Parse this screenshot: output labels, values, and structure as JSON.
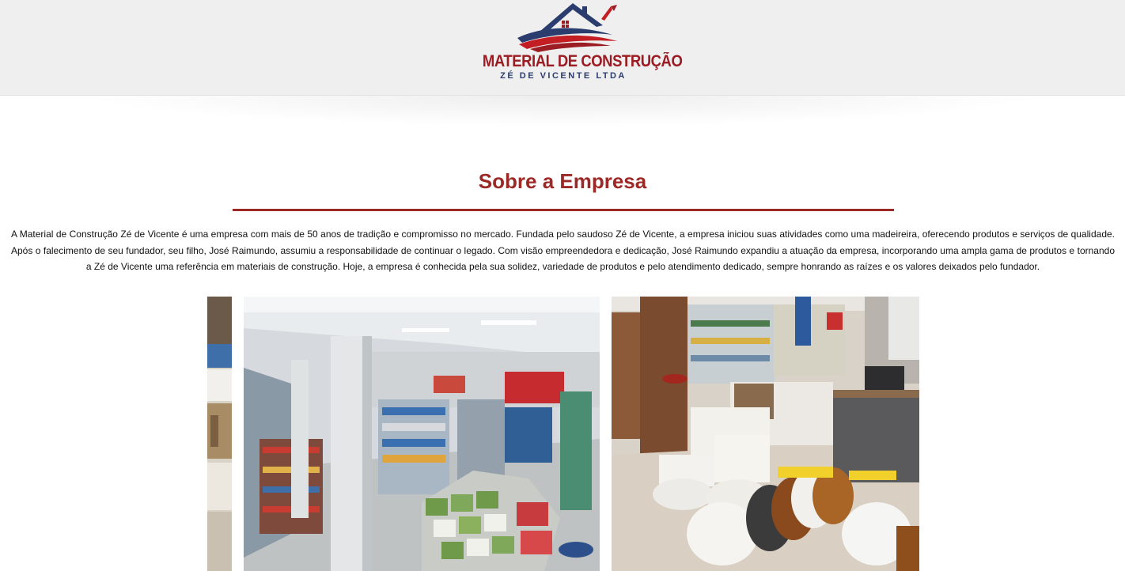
{
  "brand": {
    "title": "MATERIAL DE CONSTRUÇÃO",
    "subtitle": "ZÉ DE VICENTE LTDA",
    "colors": {
      "red": "#9b1c22",
      "navy": "#2b3d6e"
    }
  },
  "about": {
    "heading": "Sobre a Empresa",
    "body": "A Material de Construção Zé de Vicente é uma empresa com mais de 50 anos de tradição e compromisso no mercado. Fundada pelo saudoso Zé de Vicente, a empresa iniciou suas atividades como uma madeireira, oferecendo produtos e serviços de qualidade. Após o falecimento de seu fundador, seu filho, José Raimundo, assumiu a responsabilidade de continuar o legado. Com visão empreendedora e dedicação, José Raimundo expandiu a atuação da empresa, incorporando uma ampla gama de produtos e tornando a Zé de Vicente uma referência em materiais de construção. Hoje, a empresa é conhecida pela sua solidez, variedade de produtos e pelo atendimento dedicado, sempre honrando as raízes e os valores deixados pelo fundador."
  },
  "gallery": {
    "photos": [
      "store-shelves-photo",
      "store-aisles-photo",
      "bathroom-fixtures-photo"
    ]
  },
  "colors": {
    "accent": "#9b2a27",
    "header_bg": "#efefef"
  }
}
